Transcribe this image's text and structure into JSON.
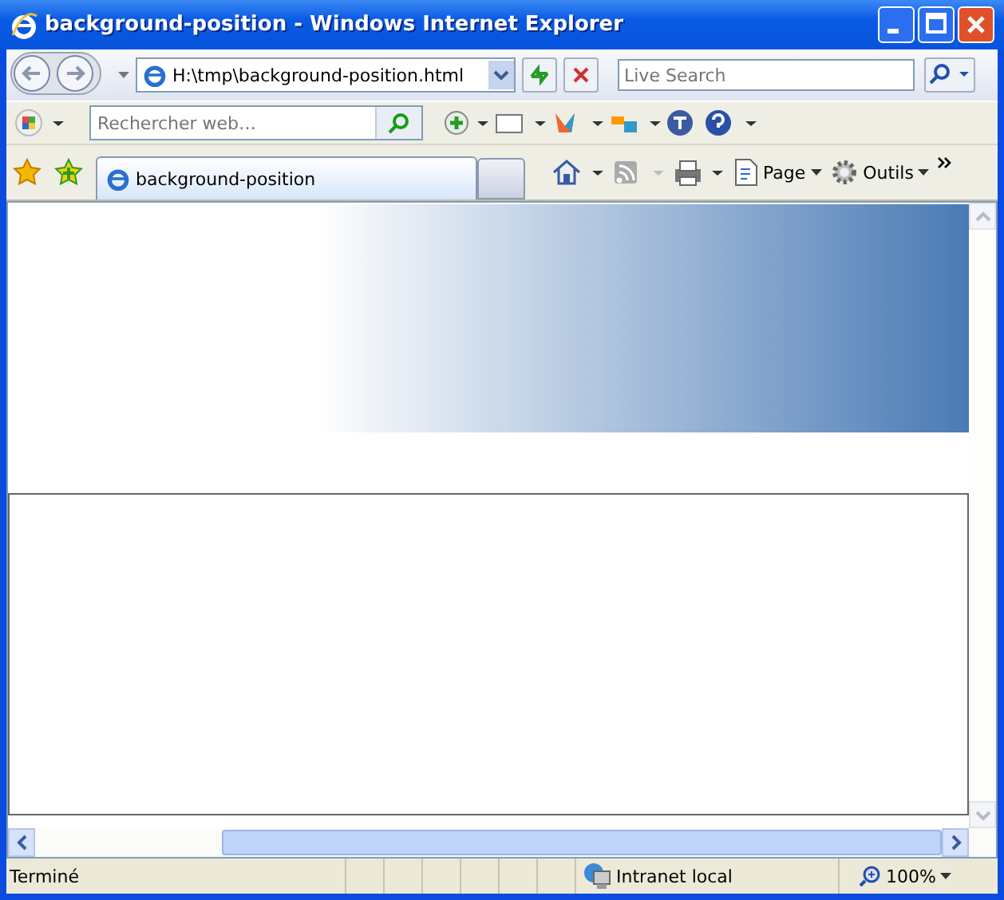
{
  "window": {
    "title": "background-position - Windows Internet Explorer"
  },
  "address_bar": {
    "value": "H:\\tmp\\background-position.html"
  },
  "search": {
    "placeholder": "Live Search"
  },
  "toolbar": {
    "search_placeholder": "Rechercher web…"
  },
  "tabs": [
    {
      "label": "background-position",
      "selected": true
    }
  ],
  "command_bar": {
    "buttons": [
      "Page",
      "Outils"
    ]
  },
  "status_bar": {
    "text": "Terminé",
    "zone": "Intranet local",
    "zoom": "100%"
  }
}
